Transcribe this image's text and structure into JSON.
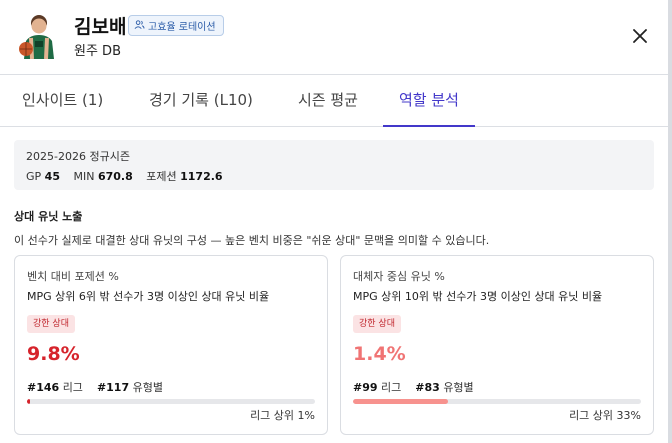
{
  "player": {
    "name": "김보배",
    "badge": "고효율 로테이션",
    "team": "원주 DB"
  },
  "tabs": [
    {
      "label": "인사이트 (1)",
      "active": false
    },
    {
      "label": "경기 기록 (L10)",
      "active": false
    },
    {
      "label": "시즌 평균",
      "active": false
    },
    {
      "label": "역할 분석",
      "active": true
    }
  ],
  "season": {
    "title": "2025-2026 정규시즌",
    "gp_label": "GP",
    "gp": "45",
    "min_label": "MIN",
    "min": "670.8",
    "poss_label": "포제션",
    "poss": "1172.6"
  },
  "section": {
    "title": "상대 유닛 노출",
    "desc": "이 선수가 실제로 대결한 상대 유닛의 구성 — 높은 벤치 비중은 \"쉬운 상대\" 문맥을 의미할 수 있습니다."
  },
  "cards": [
    {
      "title": "벤치 대비 포제션 %",
      "desc": "MPG 상위 6위 밖 선수가 3명 이상인 상대 유닛 비율",
      "tag": "강한 상대",
      "pct": "9.8%",
      "pct_color": "#d6232b",
      "league_rank": "#146",
      "league_label": "리그",
      "type_rank": "#117",
      "type_label": "유형별",
      "fill_fraction": 0.01,
      "fill_color": "#d6232b",
      "footer": "리그 상위 1%"
    },
    {
      "title": "대체자 중심 유닛 %",
      "desc": "MPG 상위 10위 밖 선수가 3명 이상인 상대 유닛 비율",
      "tag": "강한 상대",
      "pct": "1.4%",
      "pct_color": "#f07474",
      "league_rank": "#99",
      "league_label": "리그",
      "type_rank": "#83",
      "type_label": "유형별",
      "fill_fraction": 0.33,
      "fill_color": "#f7928e",
      "footer": "리그 상위 33%"
    }
  ],
  "colors": {
    "accent": "#4338ca"
  },
  "icons": {
    "badge": "users-icon",
    "close": "close-icon"
  }
}
